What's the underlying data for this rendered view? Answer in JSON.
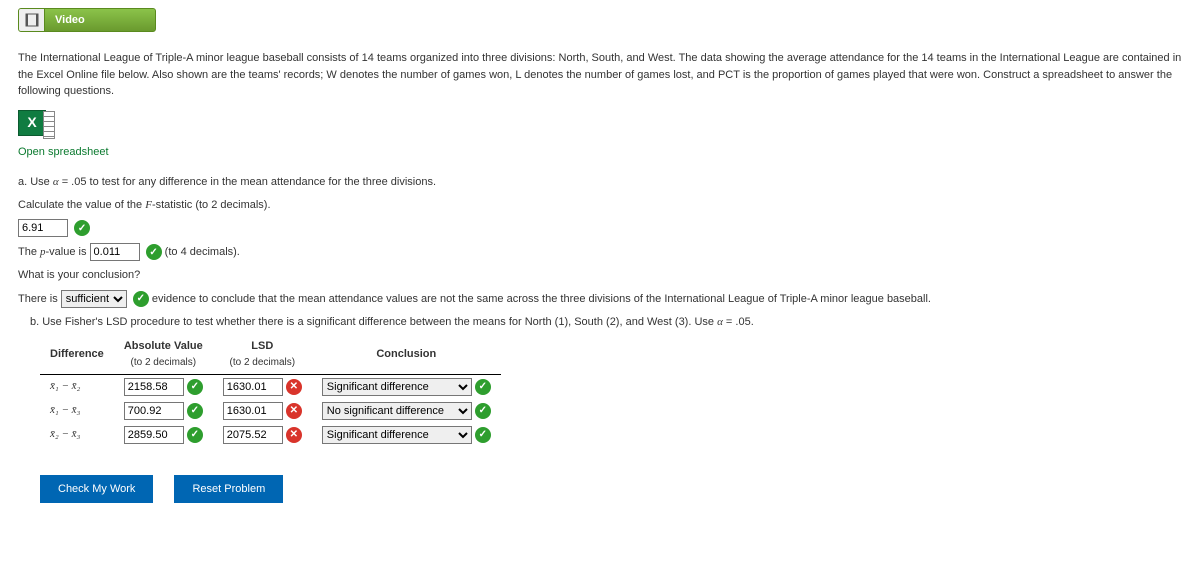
{
  "video_label": "Video",
  "intro": "The International League of Triple-A minor league baseball consists of 14 teams organized into three divisions: North, South, and West. The data showing the average attendance for the 14 teams in the International League are contained in the Excel Online file below. Also shown are the teams' records; W denotes the number of games won, L denotes the number of games lost, and PCT is the proportion of games played that were won. Construct a spreadsheet to answer the following questions.",
  "open_spreadsheet": "Open spreadsheet",
  "part_a": {
    "prompt_pre": "a. Use ",
    "alpha": "α",
    "alpha_eq": " = .05",
    "prompt_post": " to test for any difference in the mean attendance for the three divisions.",
    "calc_line_pre": "Calculate the value of the ",
    "calc_line_stat": "F",
    "calc_line_post": "-statistic (to 2 decimals).",
    "f_value": "6.91",
    "p_pre": "The ",
    "p_label": "p",
    "p_mid": "-value is ",
    "p_value": "0.011",
    "p_post": " (to 4 decimals).",
    "concl_q": "What is your conclusion?",
    "concl_pre": "There is ",
    "concl_select": "sufficient",
    "concl_post": " evidence to conclude that the mean attendance values are not the same across the three divisions of the International League of Triple-A minor league baseball."
  },
  "part_b": {
    "prefix": "b. ",
    "text_pre": "Use Fisher's LSD procedure to test whether there is a significant difference between the means for North (1), South (2), and West (3). Use ",
    "alpha": "α",
    "alpha_eq": " = .05.",
    "headers": {
      "diff": "Difference",
      "abs": "Absolute Value",
      "abs_sub": "(to 2 decimals)",
      "lsd": "LSD",
      "lsd_sub": "(to 2 decimals)",
      "concl": "Conclusion"
    },
    "rows": [
      {
        "label": "x̄₁ − x̄₂",
        "abs": "2158.58",
        "abs_ok": true,
        "lsd": "1630.01",
        "lsd_ok": false,
        "concl": "Significant difference",
        "concl_ok": true
      },
      {
        "label": "x̄₁ − x̄₃",
        "abs": "700.92",
        "abs_ok": true,
        "lsd": "1630.01",
        "lsd_ok": false,
        "concl": "No significant difference",
        "concl_ok": true
      },
      {
        "label": "x̄₂ − x̄₃",
        "abs": "2859.50",
        "abs_ok": true,
        "lsd": "2075.52",
        "lsd_ok": false,
        "concl": "Significant difference",
        "concl_ok": true
      }
    ]
  },
  "buttons": {
    "check": "Check My Work",
    "reset": "Reset Problem"
  }
}
